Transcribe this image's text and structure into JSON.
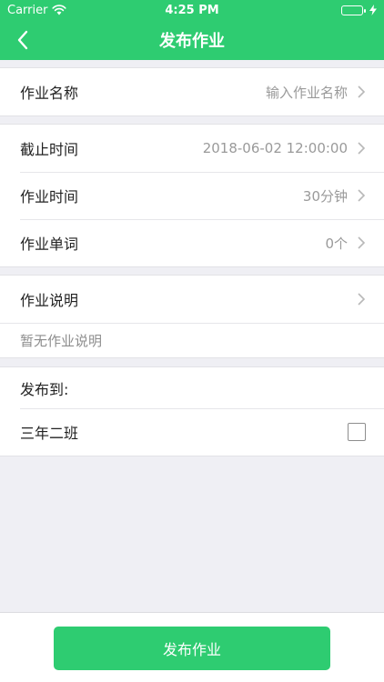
{
  "status_bar": {
    "carrier": "Carrier",
    "time": "4:25 PM"
  },
  "nav": {
    "title": "发布作业"
  },
  "form": {
    "name": {
      "label": "作业名称",
      "value": "输入作业名称"
    },
    "deadline": {
      "label": "截止时间",
      "value": "2018-06-02 12:00:00"
    },
    "duration": {
      "label": "作业时间",
      "value": "30分钟"
    },
    "words": {
      "label": "作业单词",
      "value": "0个"
    },
    "description": {
      "label": "作业说明",
      "placeholder": "暂无作业说明"
    },
    "publish_to": {
      "label": "发布到:"
    },
    "classes": [
      {
        "name": "三年二班",
        "checked": false
      }
    ]
  },
  "footer": {
    "publish_label": "发布作业"
  },
  "colors": {
    "accent": "#2ecc71",
    "background": "#efeff4"
  },
  "icons": [
    "back-chevron-icon",
    "wifi-icon",
    "battery-icon",
    "charging-bolt-icon",
    "chevron-right-icon",
    "checkbox-icon"
  ]
}
